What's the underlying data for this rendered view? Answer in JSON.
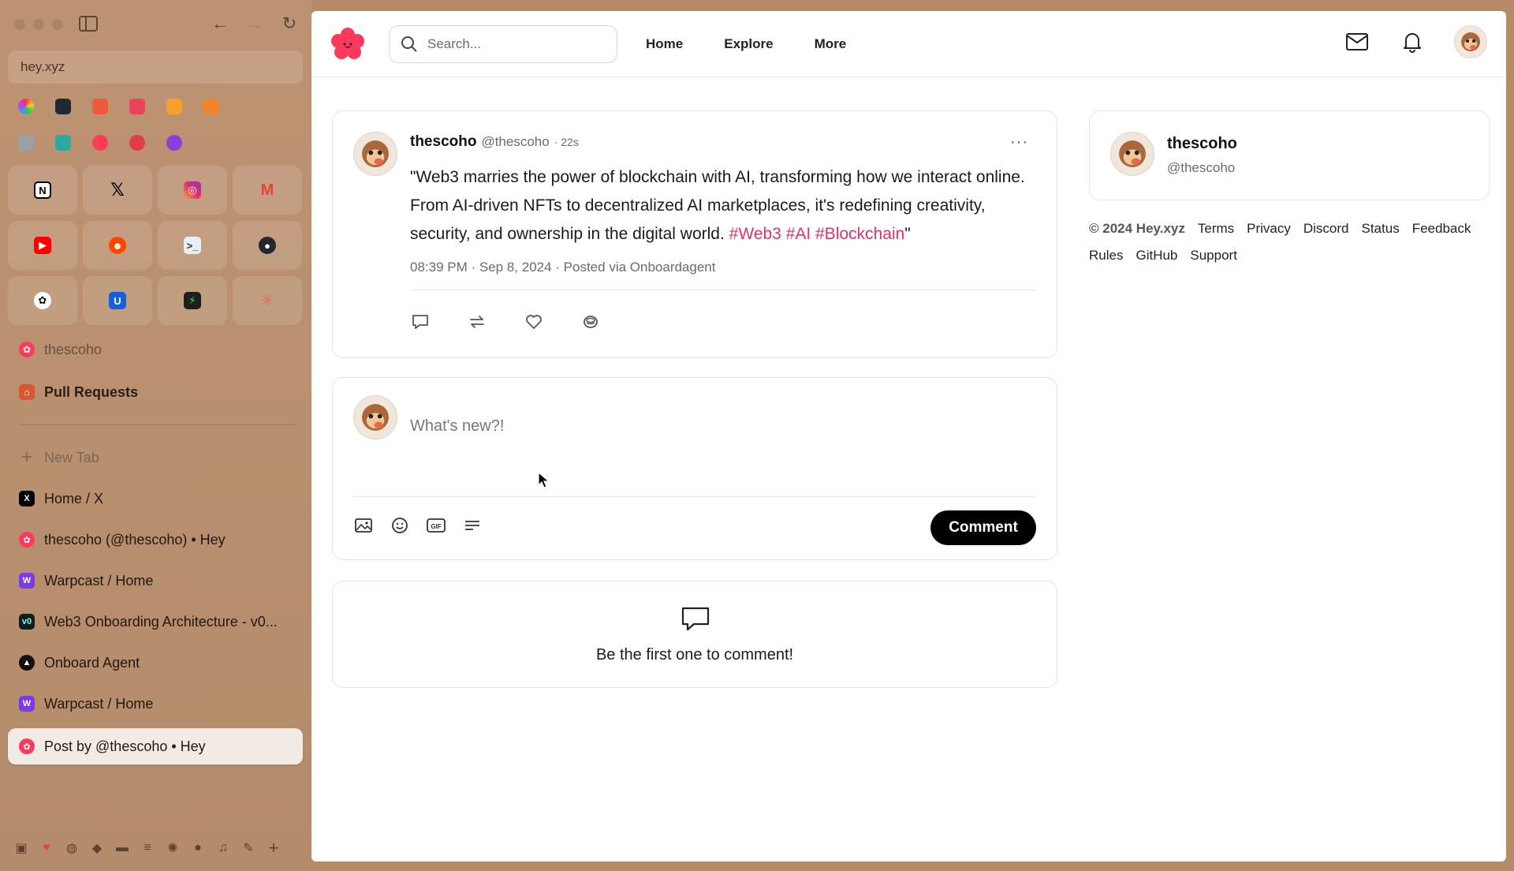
{
  "browser": {
    "url": "hey.xyz",
    "pinned": [
      {
        "label": "thescoho",
        "icon": "hey-icon"
      },
      {
        "label": "Pull Requests",
        "icon": "folder-github-icon"
      }
    ],
    "new_tab_label": "New Tab",
    "tabs": [
      {
        "label": "Home / X",
        "icon": "x-icon",
        "active": false
      },
      {
        "label": "thescoho (@thescoho) • Hey",
        "icon": "hey-icon",
        "active": false
      },
      {
        "label": "Warpcast / Home",
        "icon": "warpcast-icon",
        "active": false
      },
      {
        "label": "Web3 Onboarding Architecture - v0...",
        "icon": "v0-icon",
        "active": false
      },
      {
        "label": "Onboard Agent",
        "icon": "onboard-icon",
        "active": false
      },
      {
        "label": "Warpcast / Home",
        "icon": "warpcast-icon",
        "active": false
      },
      {
        "label": "Post by @thescoho • Hey",
        "icon": "hey-icon",
        "active": true
      }
    ]
  },
  "topnav": {
    "search_placeholder": "Search...",
    "links": [
      "Home",
      "Explore",
      "More"
    ]
  },
  "post": {
    "name": "thescoho",
    "handle": "@thescoho",
    "age": "· 22s",
    "text_before": "\"Web3 marries the power of blockchain with AI, transforming how we interact online. From AI-driven NFTs to decentralized AI marketplaces, it's redefining creativity, security, and ownership in the digital world. ",
    "hashtags": "#Web3 #AI #Blockchain",
    "text_after": "\"",
    "meta": "08:39 PM · Sep 8, 2024 · Posted via Onboardagent"
  },
  "compose": {
    "placeholder": "What's new?!",
    "button": "Comment"
  },
  "comments": {
    "empty_text": "Be the first one to comment!"
  },
  "profile": {
    "name": "thescoho",
    "handle": "@thescoho"
  },
  "footer": {
    "copyright": "© 2024 Hey.xyz",
    "links": [
      "Terms",
      "Privacy",
      "Discord",
      "Status",
      "Feedback",
      "Rules",
      "GitHub",
      "Support"
    ]
  },
  "colors": {
    "brand": "#fb3a5d",
    "hashtag": "#e0336a",
    "button": "#000000"
  }
}
